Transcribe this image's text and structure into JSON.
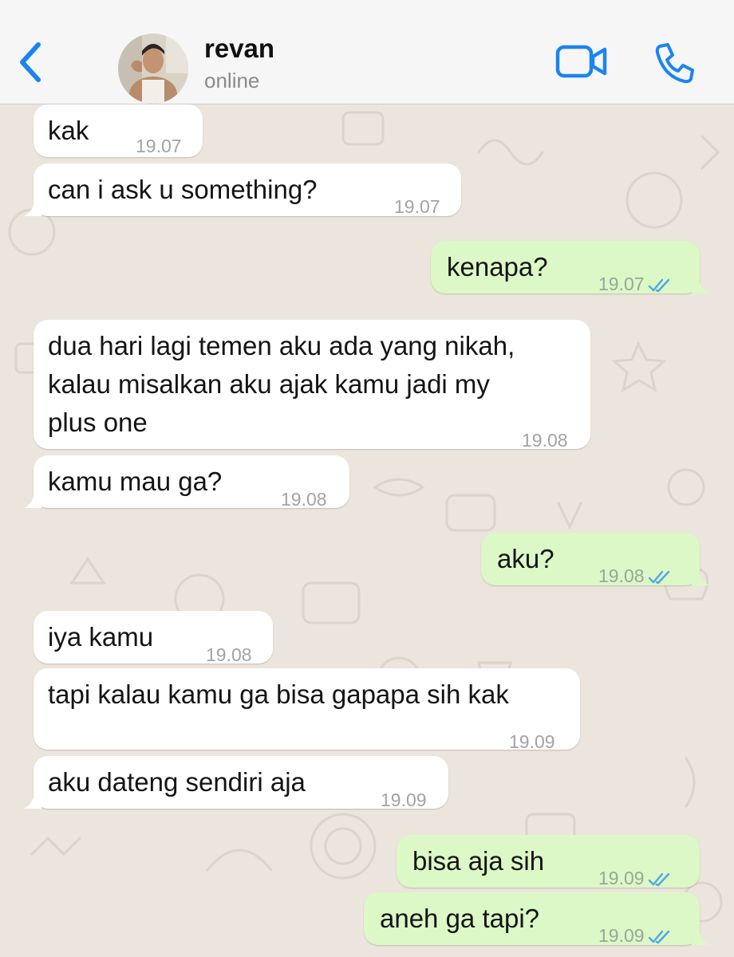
{
  "header": {
    "contact_name": "revan",
    "contact_status": "online"
  },
  "icons": {
    "back": "chevron-left-icon",
    "video_call": "video-camera-icon",
    "voice_call": "phone-icon",
    "read_receipt": "double-check-icon"
  },
  "colors": {
    "accent": "#1a84f0",
    "incoming_bubble": "#ffffff",
    "outgoing_bubble": "#dcf8c6",
    "read_ticks": "#4fa7e8",
    "wallpaper": "#ece5dd"
  },
  "messages": [
    {
      "dir": "in",
      "lines": [
        "kak"
      ],
      "time": "19.07"
    },
    {
      "dir": "in",
      "lines": [
        "can i ask u something?"
      ],
      "time": "19.07"
    },
    {
      "dir": "out",
      "lines": [
        "kenapa?"
      ],
      "time": "19.07",
      "read": true
    },
    {
      "dir": "in",
      "lines": [
        "dua hari lagi temen aku ada yang nikah,",
        "kalau misalkan aku ajak kamu jadi my",
        "plus one"
      ],
      "time": "19.08"
    },
    {
      "dir": "in",
      "lines": [
        "kamu mau ga?"
      ],
      "time": "19.08"
    },
    {
      "dir": "out",
      "lines": [
        "aku?"
      ],
      "time": "19.08",
      "read": true
    },
    {
      "dir": "in",
      "lines": [
        "iya kamu"
      ],
      "time": "19.08"
    },
    {
      "dir": "in",
      "lines": [
        "tapi kalau kamu ga bisa gapapa sih kak"
      ],
      "time": "19.09"
    },
    {
      "dir": "in",
      "lines": [
        "aku dateng sendiri aja"
      ],
      "time": "19.09"
    },
    {
      "dir": "out",
      "lines": [
        "bisa aja sih"
      ],
      "time": "19.09",
      "read": true
    },
    {
      "dir": "out",
      "lines": [
        "aneh ga tapi?"
      ],
      "time": "19.09",
      "read": true
    }
  ]
}
